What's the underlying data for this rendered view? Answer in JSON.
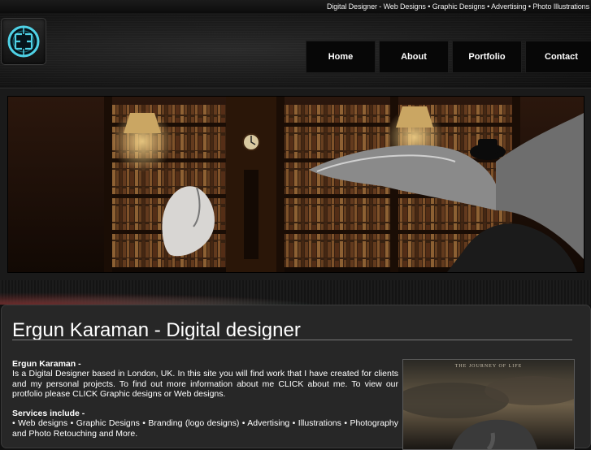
{
  "tagline": "Digital Designer - Web Designs • Graphic Designs • Advertising • Photo Illustrations",
  "nav": {
    "items": [
      "Home",
      "About",
      "Portfolio",
      "Contact"
    ]
  },
  "main": {
    "title": "Ergun Karaman - Digital designer",
    "intro_heading": "Ergun Karaman -",
    "intro_text": "Is a Digital Designer based in London, UK. In this site you will find work that I have created for clients and my personal projects. To find out more information about me CLICK about me. To view our protfolio please CLICK Graphic designs or Web designs.",
    "services_heading": "Services include -",
    "services_text": "• Web designs • Graphic Designs • Branding (logo designs) • Advertising • Illustrations • Photography and Photo Retouching and More."
  },
  "thumbnail": {
    "caption": "THE JOURNEY OF LIFE"
  },
  "colors": {
    "background": "#111111",
    "panel": "#272727",
    "nav": "#070707",
    "accent": "#4fd2e6"
  },
  "icons": {
    "logo": "ek-monogram-logo"
  }
}
